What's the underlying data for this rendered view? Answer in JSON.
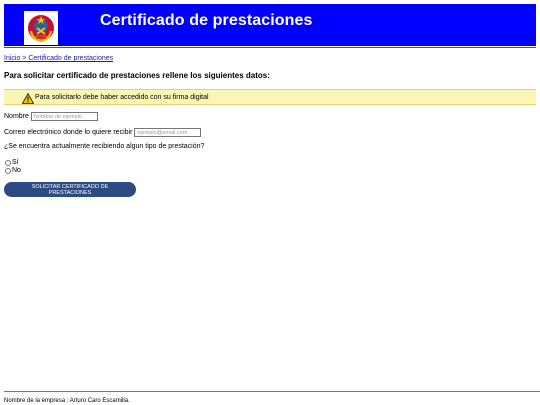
{
  "header": {
    "title": "Certificado de prestaciones",
    "background_color": "#0000ff",
    "logo_icon": "emblem-icon"
  },
  "breadcrumb": {
    "text": "Inicio > Certificado de prestaciones"
  },
  "form": {
    "heading": "Para solicitar certificado de prestaciones rellene los siguientes datos:",
    "warning": {
      "icon": "warning-icon",
      "text": "Para solicitarlo debe haber accedido con su firma digital",
      "background_color": "#fdf5b6"
    },
    "name_label": "Nombre",
    "name_placeholder": "Nombre de ejemplo",
    "email_label": "Correo electrónico donde lo quiere recibir",
    "email_placeholder": "ejemplo@email.com",
    "question": "¿Se encuentra actualmente recibiendo algun tipo de prestación?",
    "options": [
      "Sí",
      "No"
    ],
    "submit_label": "SOLICITAR CERTIFICADO DE PRESTACIONES",
    "button_color": "#2c4b82"
  },
  "footer": {
    "text": "Nombre de la empresa : Arturo Caro Escamilla."
  }
}
